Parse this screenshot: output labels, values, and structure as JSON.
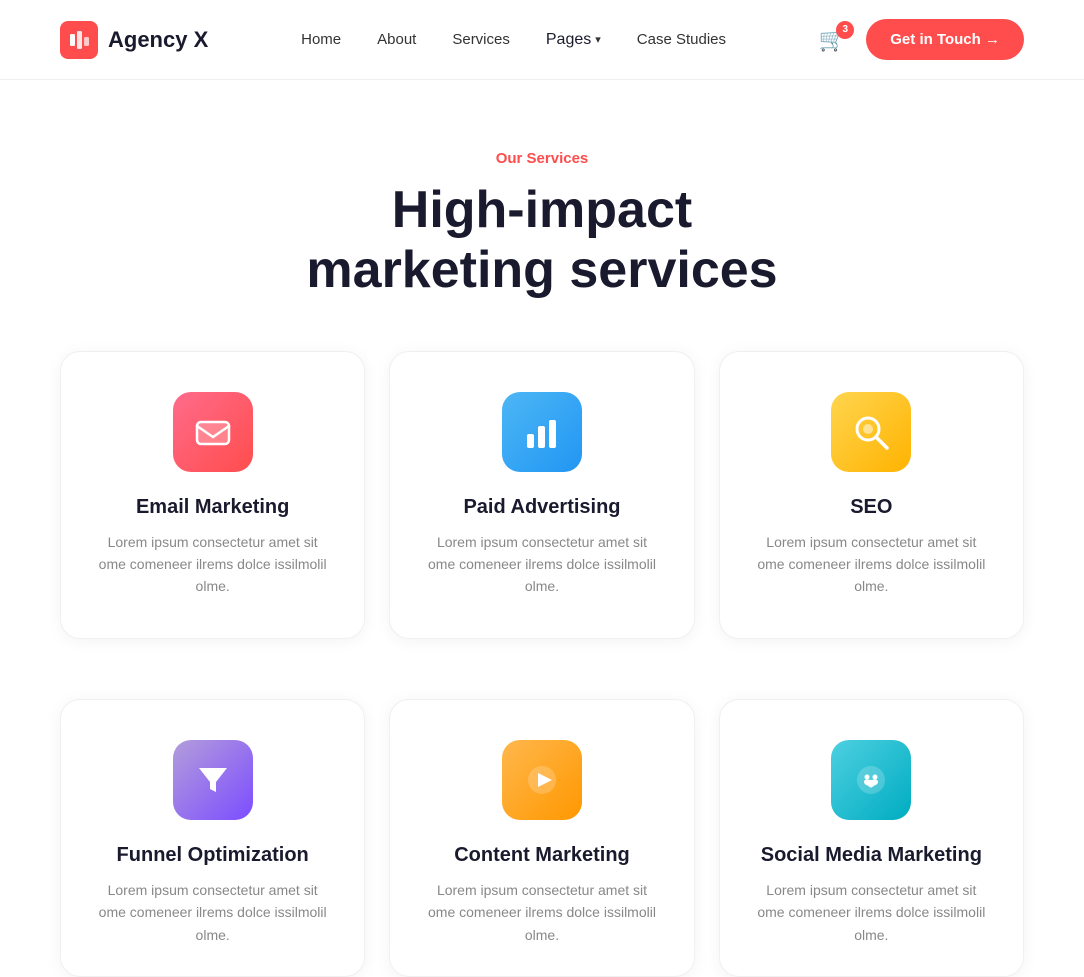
{
  "logo": {
    "name": "Agency X",
    "icon_symbol": "▐▌"
  },
  "nav": {
    "links": [
      {
        "label": "Home",
        "href": "#"
      },
      {
        "label": "About",
        "href": "#"
      },
      {
        "label": "Services",
        "href": "#"
      },
      {
        "label": "Pages",
        "href": "#",
        "has_dropdown": true
      },
      {
        "label": "Case Studies",
        "href": "#"
      }
    ],
    "cart_count": "3",
    "cta_label": "Get in Touch →"
  },
  "section": {
    "tag": "Our Services",
    "title_line1": "High-impact",
    "title_line2": "marketing services"
  },
  "services_row1": [
    {
      "id": "email",
      "title": "Email Marketing",
      "desc": "Lorem ipsum consectetur amet sit ome comeneer ilrems dolce issilmolil olme.",
      "icon_type": "email"
    },
    {
      "id": "ads",
      "title": "Paid Advertising",
      "desc": "Lorem ipsum consectetur amet sit ome comeneer ilrems dolce issilmolil olme.",
      "icon_type": "ads"
    },
    {
      "id": "seo",
      "title": "SEO",
      "desc": "Lorem ipsum consectetur amet sit ome comeneer ilrems dolce issilmolil olme.",
      "icon_type": "seo"
    }
  ],
  "services_row2": [
    {
      "id": "funnel",
      "title": "Funnel Optimization",
      "desc": "Lorem ipsum consectetur amet sit ome comeneer ilrems dolce issilmolil olme.",
      "icon_type": "funnel"
    },
    {
      "id": "content",
      "title": "Content Marketing",
      "desc": "Lorem ipsum consectetur amet sit ome comeneer ilrems dolce issilmolil olme.",
      "icon_type": "content"
    },
    {
      "id": "social",
      "title": "Social Media Marketing",
      "desc": "Lorem ipsum consectetur amet sit ome comeneer ilrems dolce issilmolil olme.",
      "icon_type": "social"
    }
  ]
}
